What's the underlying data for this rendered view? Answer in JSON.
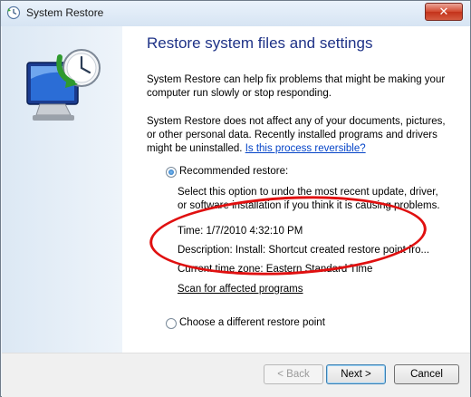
{
  "window": {
    "title": "System Restore",
    "close_label": "✕"
  },
  "main": {
    "heading": "Restore system files and settings",
    "intro": "System Restore can help fix problems that might be making your computer run slowly or stop responding.",
    "info_text": "System Restore does not affect any of your documents, pictures, or other personal data. Recently installed programs and drivers might be uninstalled.",
    "info_link": "Is this process reversible?"
  },
  "recommended": {
    "label": "Recommended restore:",
    "description": "Select this option to undo the most recent update, driver, or software installation if you think it is causing problems.",
    "time": "Time: 1/7/2010 4:32:10 PM",
    "desc_line": "Description: Install: Shortcut created restore point fro...",
    "timezone": "Current time zone: Eastern Standard Time",
    "scan_link": "Scan for affected programs",
    "selected": true
  },
  "alternate": {
    "label": "Choose a different restore point",
    "selected": false
  },
  "buttons": {
    "back": "< Back",
    "next": "Next >",
    "cancel": "Cancel"
  },
  "colors": {
    "heading": "#1e3287",
    "link": "#0645c8",
    "annotation": "#e01010"
  }
}
